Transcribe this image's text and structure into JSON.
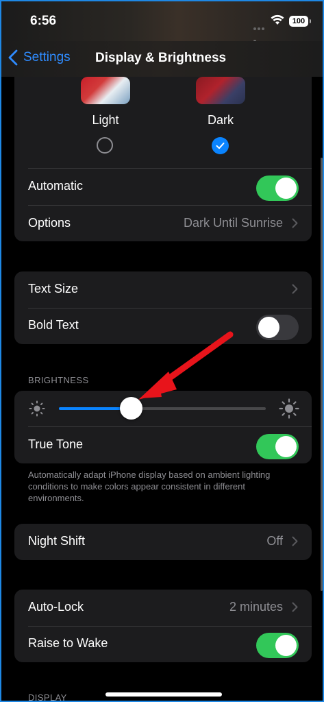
{
  "status_bar": {
    "time": "6:56",
    "battery": "100"
  },
  "nav": {
    "back_label": "Settings",
    "title": "Display & Brightness"
  },
  "appearance": {
    "options": [
      {
        "label": "Light",
        "selected": false
      },
      {
        "label": "Dark",
        "selected": true
      }
    ],
    "automatic": {
      "label": "Automatic",
      "on": true
    },
    "options_row": {
      "label": "Options",
      "value": "Dark Until Sunrise"
    }
  },
  "text": {
    "text_size": {
      "label": "Text Size"
    },
    "bold_text": {
      "label": "Bold Text",
      "on": false
    }
  },
  "brightness": {
    "header": "BRIGHTNESS",
    "level": 0.35,
    "true_tone": {
      "label": "True Tone",
      "on": true
    },
    "footnote": "Automatically adapt iPhone display based on ambient lighting conditions to make colors appear consistent in different environments."
  },
  "night_shift": {
    "label": "Night Shift",
    "value": "Off"
  },
  "lock": {
    "auto_lock": {
      "label": "Auto-Lock",
      "value": "2 minutes"
    },
    "raise_to_wake": {
      "label": "Raise to Wake",
      "on": true
    }
  },
  "display_header": "DISPLAY",
  "colors": {
    "accent": "#0a84ff",
    "toggle_on": "#32c759",
    "annotation_arrow": "#e8141b"
  }
}
